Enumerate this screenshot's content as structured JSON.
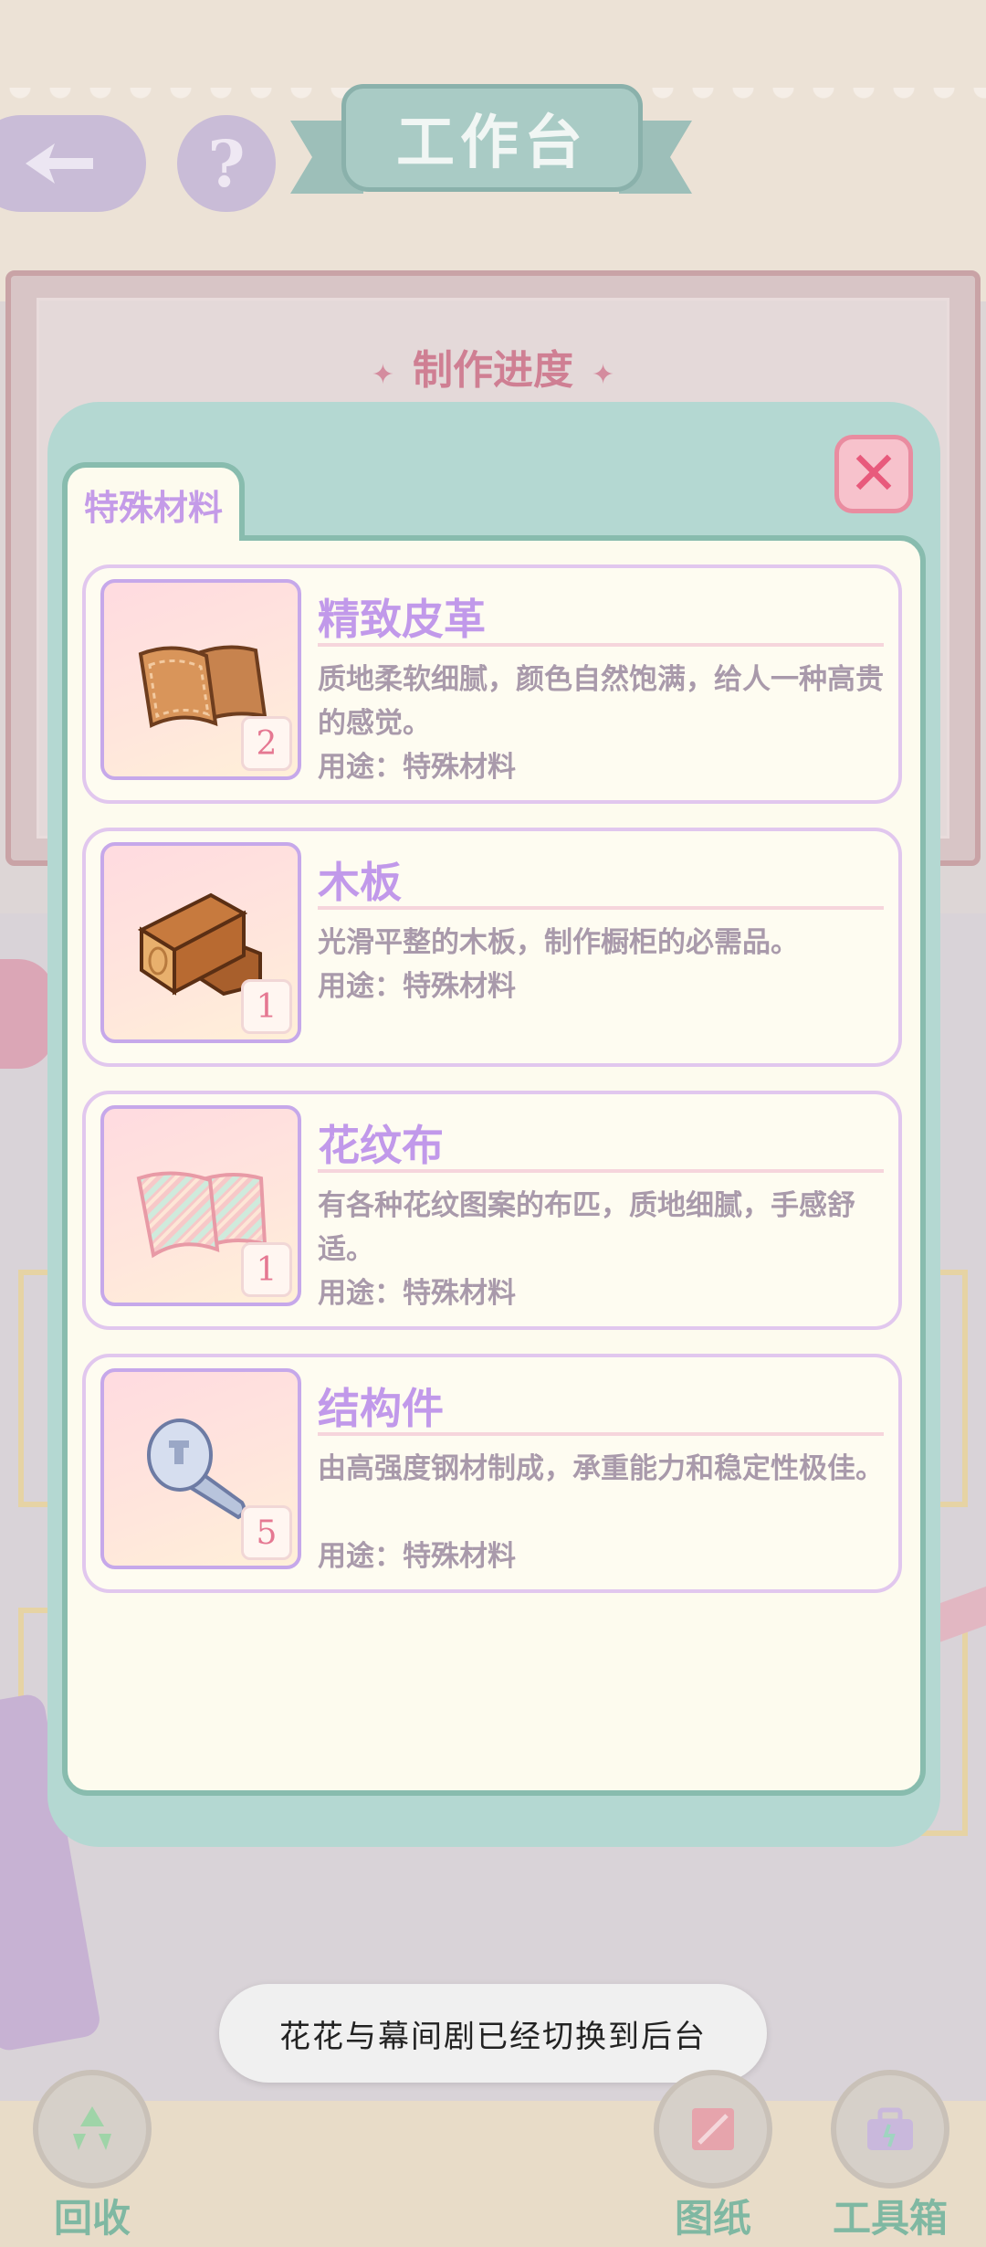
{
  "header": {
    "title": "工作台",
    "help_label": "?"
  },
  "background": {
    "progress_title": "制作进度"
  },
  "modal": {
    "tab_label": "特殊材料",
    "close_label": "✕",
    "items": [
      {
        "name": "精致皮革",
        "count": "2",
        "description": "质地柔软细腻，颜色自然饱满，给人一种高贵的感觉。",
        "use": "用途：特殊材料",
        "icon": "leather-icon"
      },
      {
        "name": "木板",
        "count": "1",
        "description": "光滑平整的木板，制作橱柜的必需品。",
        "use": "用途：特殊材料",
        "icon": "wood-plank-icon"
      },
      {
        "name": "花纹布",
        "count": "1",
        "description": "有各种花纹图案的布匹，质地细腻，手感舒适。",
        "use": "用途：特殊材料",
        "icon": "patterned-cloth-icon"
      },
      {
        "name": "结构件",
        "count": "5",
        "description": "由高强度钢材制成，承重能力和稳定性极佳。",
        "use": "用途：特殊材料",
        "icon": "screw-icon"
      }
    ]
  },
  "toast": {
    "message": "花花与幕间剧已经切换到后台"
  },
  "bottom_nav": {
    "recycle": "回收",
    "blueprint": "图纸",
    "toolbox": "工具箱"
  },
  "colors": {
    "accent_purple": "#c199ea",
    "panel_teal": "#b4d8d2",
    "close_pink": "#e85a7c"
  }
}
